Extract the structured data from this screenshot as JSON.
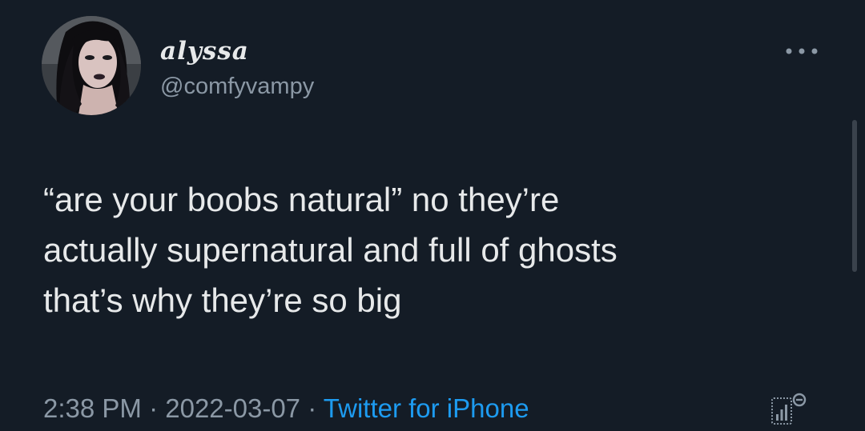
{
  "author": {
    "display_name": "alyssa",
    "handle": "@comfyvampy",
    "avatar_icon": "profile-photo"
  },
  "more_icon": "more-horizontal-icon",
  "tweet": {
    "text": "“are your boobs natural” no they’re\nactually supernatural and full of ghosts\nthat’s why they’re so big"
  },
  "meta": {
    "time": "2:38 PM",
    "separator_1": " · ",
    "date": "2022-03-07",
    "separator_2": " · ",
    "source": "Twitter for iPhone"
  },
  "analytics_icon": "analytics-icon",
  "colors": {
    "background": "#141c26",
    "text": "#e7e9ea",
    "secondary_text": "#8b98a5",
    "link": "#1d9bf0"
  }
}
